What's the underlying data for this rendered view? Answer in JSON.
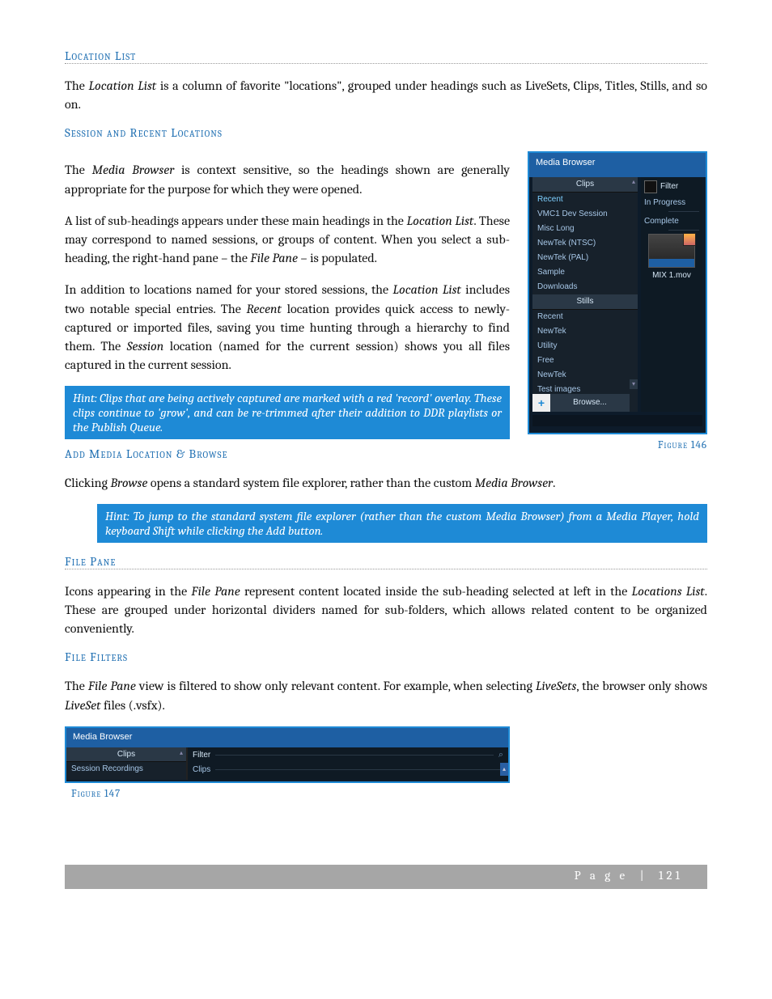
{
  "headings": {
    "location_list": "Location List",
    "session_recent": "Session and Recent Locations",
    "add_browse": "Add Media Location & Browse",
    "file_pane": "File Pane",
    "file_filters": "File Filters"
  },
  "paragraphs": {
    "loc_list_1_a": "The ",
    "loc_list_1_b": "Location List",
    "loc_list_1_c": " is a column of favorite \"locations\", grouped under headings such as LiveSets, Clips, Titles, Stills, and so on.",
    "session_1_a": "The ",
    "session_1_b": "Media Browser",
    "session_1_c": " is context sensitive, so the headings shown are generally appropriate for the purpose for which they were opened.",
    "session_2_a": "A list of sub-headings appears under these main headings in the ",
    "session_2_b": "Location List",
    "session_2_c": ".  These may correspond to named sessions, or groups of content.  When you select a sub-heading, the right-hand pane – the ",
    "session_2_d": "File Pane",
    "session_2_e": " – is populated.",
    "session_3_a": "In addition to locations named for your stored sessions, the ",
    "session_3_b": "Location List",
    "session_3_c": " includes two notable special entries. The ",
    "session_3_d": "Recent",
    "session_3_e": " location provides quick access to newly-captured or imported files, saving you time hunting through a hierarchy to find them.  The ",
    "session_3_f": "Session",
    "session_3_g": " location (named for the current session) shows you all files captured in the current session.",
    "hint1": "Hint: Clips that are being actively captured are marked with a red 'record' overlay.  These clips continue to 'grow', and can be re-trimmed after their addition to DDR playlists or the Publish Queue.",
    "add_1_a": "Clicking ",
    "add_1_b": "Browse",
    "add_1_c": " opens a standard system file explorer, rather than the custom ",
    "add_1_d": "Media Browser",
    "add_1_e": ".",
    "hint2": "Hint: To jump to the standard system file explorer (rather than the custom Media Browser) from a Media Player, hold keyboard Shift while clicking the Add button.",
    "fp_1_a": "Icons appearing in the ",
    "fp_1_b": "File Pane",
    "fp_1_c": " represent content located inside the sub-heading selected at left in the ",
    "fp_1_d": "Locations List",
    "fp_1_e": ".  These are grouped under horizontal dividers named for sub-folders, which allows related content to be organized conveniently.",
    "ff_1_a": "The ",
    "ff_1_b": "File Pane",
    "ff_1_c": " view is filtered to show only relevant content. For example, when selecting ",
    "ff_1_d": "LiveSets",
    "ff_1_e": ", the browser only shows ",
    "ff_1_f": "LiveSet",
    "ff_1_g": " files (.vsfx)."
  },
  "figure146": {
    "title": "Media Browser",
    "clips_header": "Clips",
    "stills_header": "Stills",
    "items_clips": [
      "Recent",
      "VMC1 Dev Session",
      "Misc Long",
      "NewTek (NTSC)",
      "NewTek (PAL)",
      "Sample",
      "Downloads"
    ],
    "items_stills": [
      "Recent",
      "NewTek",
      "Utility",
      "Free",
      "NewTek",
      "Test images"
    ],
    "filter_label": "Filter",
    "in_progress": "In Progress",
    "complete": "Complete",
    "thumb_name": "MIX 1.mov",
    "browse_label": "Browse...",
    "caption": "Figure 146"
  },
  "figure147": {
    "title": "Media Browser",
    "clips_header": "Clips",
    "session_recordings": "Session Recordings",
    "filter_label": "Filter",
    "clips_label": "Clips",
    "caption": "Figure 147"
  },
  "footer": {
    "page_label": "P a g e",
    "separator": "|",
    "page_number": "121"
  }
}
